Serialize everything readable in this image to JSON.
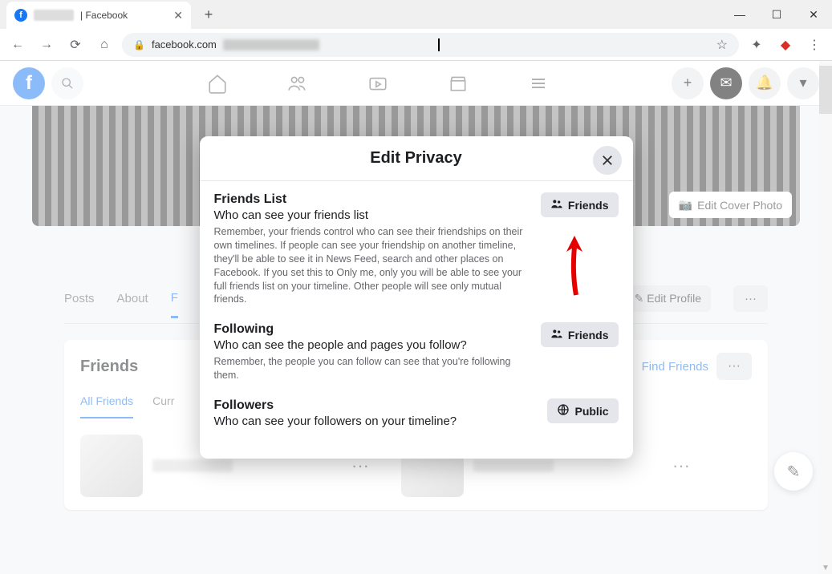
{
  "browser": {
    "tab_title": "| Facebook",
    "url_host": "facebook.com"
  },
  "header": {
    "search_icon": "search"
  },
  "cover": {
    "edit_label": "Edit Cover Photo"
  },
  "profnav": {
    "posts": "Posts",
    "about": "About",
    "friends": "F",
    "edit": "Edit Profile"
  },
  "friends": {
    "title": "Friends",
    "find": "Find Friends",
    "tabs": {
      "all": "All Friends",
      "curr": "Curr"
    }
  },
  "modal": {
    "title": "Edit Privacy",
    "sections": [
      {
        "title": "Friends List",
        "sub": "Who can see your friends list",
        "desc": "Remember, your friends control who can see their friendships on their own timelines. If people can see your friendship on another timeline, they'll be able to see it in News Feed, search and other places on Facebook. If you set this to Only me, only you will be able to see your full friends list on your timeline. Other people will see only mutual friends.",
        "audience": "Friends",
        "audience_icon": "friends"
      },
      {
        "title": "Following",
        "sub": "Who can see the people and pages you follow?",
        "desc": "Remember, the people you can follow can see that you're following them.",
        "audience": "Friends",
        "audience_icon": "friends"
      },
      {
        "title": "Followers",
        "sub": "Who can see your followers on your timeline?",
        "desc": "",
        "audience": "Public",
        "audience_icon": "globe"
      }
    ]
  }
}
